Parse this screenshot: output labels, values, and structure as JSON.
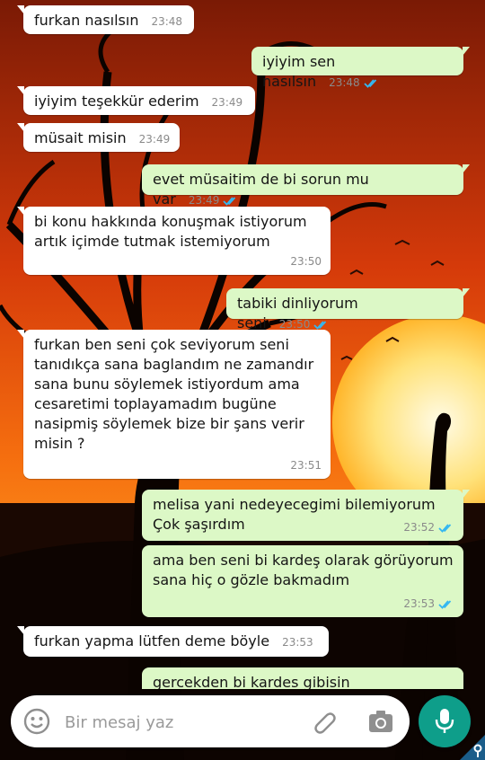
{
  "messages": [
    {
      "dir": "in",
      "text": "furkan nasılsın",
      "time": "23:48"
    },
    {
      "dir": "out",
      "text": "iyiyim sen nasılsın",
      "time": "23:48"
    },
    {
      "dir": "in",
      "text": "iyiyim teşekkür ederim",
      "time": "23:49"
    },
    {
      "dir": "in",
      "text": "müsait misin",
      "time": "23:49"
    },
    {
      "dir": "out",
      "text": "evet müsaitim de bi sorun mu var",
      "time": "23:49"
    },
    {
      "dir": "in",
      "text": "bi konu hakkında konuşmak istiyorum artık içimde tutmak istemiyorum",
      "time": "23:50"
    },
    {
      "dir": "out",
      "text": "tabiki dinliyorum seni",
      "time": "23:50"
    },
    {
      "dir": "in",
      "text": "furkan ben seni çok seviyorum seni tanıdıkça sana baglandım ne zamandır sana bunu söylemek istiyordum ama cesaretimi toplayamadım bugüne nasipmiş söylemek bize bir şans verir misin ?",
      "time": "23:51"
    },
    {
      "dir": "out",
      "text": "melisa yani nedeyecegimi bilemiyorum Çok şaşırdım",
      "time": "23:52"
    },
    {
      "dir": "out",
      "text": "ama ben seni bi kardeş olarak görüyorum sana hiç o gözle bakmadım",
      "time": "23:53"
    },
    {
      "dir": "in",
      "text": "furkan yapma lütfen deme böyle",
      "time": "23:53"
    },
    {
      "dir": "out",
      "text": "gercekden bi kardes gibisin",
      "time": ""
    }
  ],
  "composer": {
    "placeholder": "Bir mesaj yaz"
  },
  "colors": {
    "incoming": "#ffffff",
    "outgoing": "#dcf8c6",
    "read_tick": "#34b7f1",
    "mic": "#0e9e8a"
  },
  "icons": {
    "emoji": "smiley-icon",
    "attach": "paperclip-icon",
    "camera": "camera-icon",
    "mic": "microphone-icon",
    "status": "double-check-icon"
  }
}
